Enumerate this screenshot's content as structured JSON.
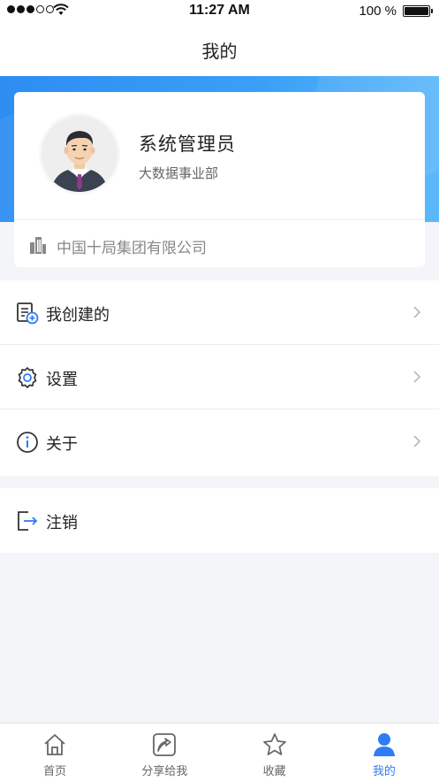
{
  "status_bar": {
    "time": "11:27 AM",
    "battery": "100 %"
  },
  "header": {
    "title": "我的"
  },
  "profile": {
    "name": "系统管理员",
    "department": "大数据事业部",
    "company": "中国十局集团有限公司"
  },
  "menu": {
    "created_by_me": "我创建的",
    "settings": "设置",
    "about": "关于",
    "logout": "注销"
  },
  "tab_bar": {
    "home": "首页",
    "shared": "分享给我",
    "favorites": "收藏",
    "mine": "我的"
  },
  "colors": {
    "accent": "#2e7cf6",
    "header_blue": "#3aa0f7"
  }
}
